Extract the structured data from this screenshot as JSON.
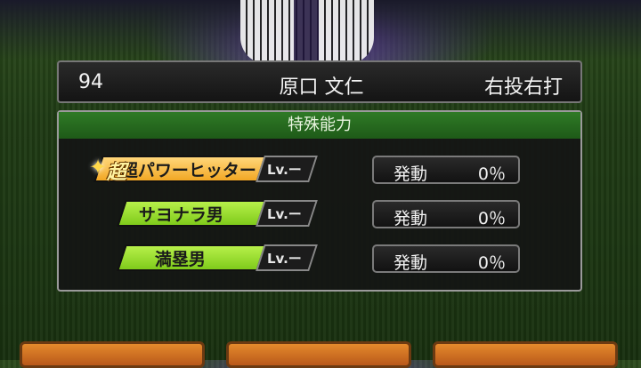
{
  "player": {
    "number": "94",
    "name": "原口 文仁",
    "handedness": "右投右打"
  },
  "special_abilities": {
    "title": "特殊能力",
    "items": [
      {
        "name": "超パワーヒッター",
        "prefix_icon": "star-icon",
        "prefix_char": "超",
        "level": "Lv.ー",
        "activation_label": "発動",
        "activation_value": "0％",
        "tier": "gold"
      },
      {
        "name": "サヨナラ男",
        "level": "Lv.ー",
        "activation_label": "発動",
        "activation_value": "0％",
        "tier": "green"
      },
      {
        "name": "満塁男",
        "level": "Lv.ー",
        "activation_label": "発動",
        "activation_value": "0％",
        "tier": "green"
      }
    ]
  },
  "colors": {
    "gold_tag": "#f2a724",
    "green_tag": "#7fcb1b",
    "panel_header": "#2f7a26",
    "bottom_button": "#e48a2c"
  }
}
